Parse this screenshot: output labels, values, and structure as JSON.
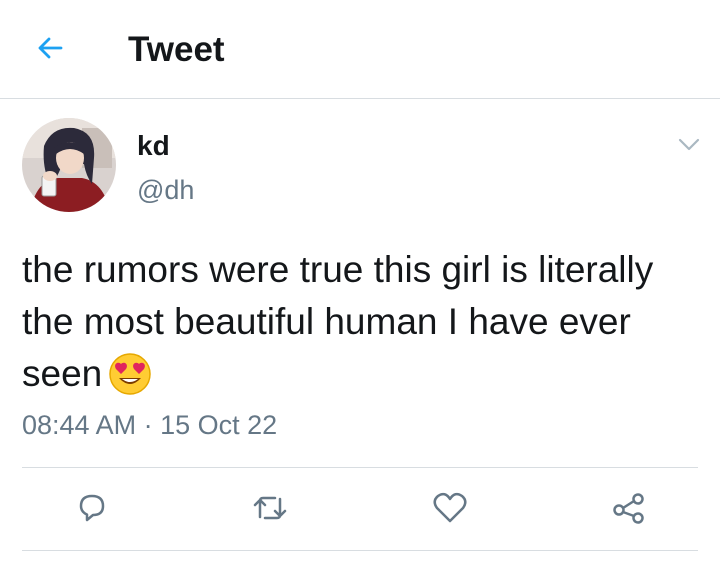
{
  "header": {
    "back_icon": "arrow-left-icon",
    "title": "Tweet"
  },
  "tweet": {
    "author": {
      "display_name": "kd",
      "handle": "@dh"
    },
    "text": "the rumors were true this girl is literally the most beautiful human I have ever seen",
    "emoji": "heart-eyes-emoji",
    "time": "08:44 AM",
    "separator": "·",
    "date": "15 Oct 22"
  },
  "actions": [
    {
      "icon": "reply-icon"
    },
    {
      "icon": "retweet-icon"
    },
    {
      "icon": "like-icon"
    },
    {
      "icon": "share-icon"
    }
  ],
  "colors": {
    "accent": "#1da1f2",
    "text": "#14171a",
    "secondary": "#657786",
    "divider": "#d8dde1"
  }
}
